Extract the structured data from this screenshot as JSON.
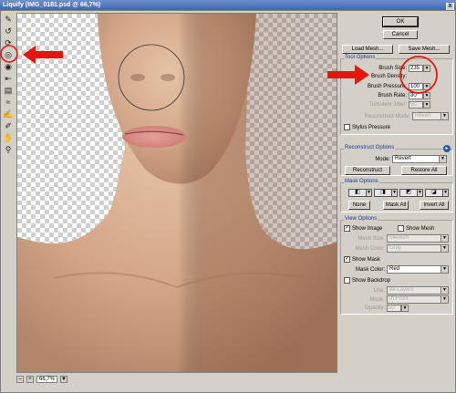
{
  "window": {
    "title": "Liquify (IMG_0181.psd @ 66,7%)",
    "close_label": "X"
  },
  "toolbar": {
    "icons": [
      "forward-warp-icon",
      "reconstruct-icon",
      "twirl-icon",
      "pucker-icon",
      "bloat-icon",
      "push-left-icon",
      "mirror-icon",
      "turbulence-icon",
      "freeze-mask-icon",
      "thaw-mask-icon",
      "hand-icon",
      "zoom-icon"
    ],
    "glyphs": [
      "✎",
      "↺",
      "⟳",
      "◎",
      "◉",
      "⇤",
      "▤",
      "≈",
      "✍",
      "✐",
      "✋",
      "⚲"
    ]
  },
  "status": {
    "minus": "–",
    "zoom_value": "66,7%",
    "plus": "+",
    "zoom_arrow": "▼"
  },
  "actions": {
    "ok": "OK",
    "cancel": "Cancel",
    "load_mesh": "Load Mesh...",
    "save_mesh": "Save Mesh..."
  },
  "tool_options": {
    "title": "Tool Options",
    "brush_size_label": "Brush Size:",
    "brush_size": "235",
    "brush_density_label": "Brush Density:",
    "brush_pressure_label": "Brush Pressure:",
    "brush_pressure": "100",
    "brush_rate_label": "Brush Rate:",
    "brush_rate": "80",
    "turbulent_jitter_label": "Turbulent Jitter:",
    "turbulent_jitter": "50",
    "reconstruct_mode_label": "Reconstruct Mode:",
    "reconstruct_mode": "Revert",
    "stylus_pressure": "Stylus Pressure"
  },
  "reconstruct_options": {
    "title": "Reconstruct Options",
    "mode_label": "Mode:",
    "mode": "Revert",
    "reconstruct_button": "Reconstruct",
    "restore_all_button": "Restore All"
  },
  "mask_options": {
    "title": "Mask Options",
    "none_button": "None",
    "mask_all_button": "Mask All",
    "invert_all_button": "Invert All"
  },
  "view_options": {
    "title": "View Options",
    "show_image": "Show Image",
    "show_mesh": "Show Mesh",
    "mesh_size_label": "Mesh Size:",
    "mesh_size": "Medium",
    "mesh_color_label": "Mesh Color:",
    "mesh_color": "Gray",
    "show_mask": "Show Mask",
    "mask_color_label": "Mask Color:",
    "mask_color": "Red",
    "show_backdrop": "Show Backdrop",
    "use_label": "Use:",
    "use": "All Layers",
    "mode_label": "Mode:",
    "mode": "In Front",
    "opacity_label": "Opacity:",
    "opacity": "50",
    "checked_glyph": "✓"
  },
  "annotations": {
    "color": "#e8150f"
  }
}
